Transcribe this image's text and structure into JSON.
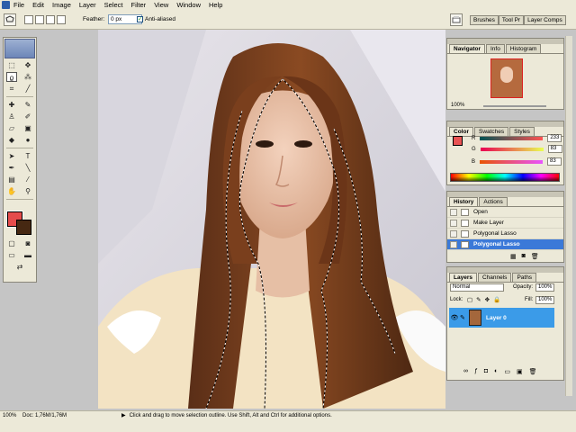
{
  "menu": [
    "File",
    "Edit",
    "Image",
    "Layer",
    "Select",
    "Filter",
    "View",
    "Window",
    "Help"
  ],
  "options": {
    "feather_label": "Feather:",
    "feather_value": "0 px",
    "anti_alias_label": "Anti-aliased",
    "well_tabs": [
      "Brushes",
      "Tool Pr",
      "Layer Comps"
    ]
  },
  "navigator": {
    "tabs": [
      "Navigator",
      "Info",
      "Histogram"
    ],
    "zoom": "100%"
  },
  "color": {
    "tabs": [
      "Color",
      "Swatches",
      "Styles"
    ],
    "channels": [
      {
        "label": "R",
        "value": "233"
      },
      {
        "label": "G",
        "value": "83"
      },
      {
        "label": "B",
        "value": "83"
      }
    ],
    "fg": "#e95353",
    "bg": "#462812"
  },
  "history": {
    "tabs": [
      "History",
      "Actions"
    ],
    "items": [
      "Open",
      "Make Layer",
      "Polygonal Lasso",
      "Polygonal Lasso"
    ]
  },
  "layers": {
    "tabs": [
      "Layers",
      "Channels",
      "Paths"
    ],
    "blend_mode": "Normal",
    "opacity_label": "Opacity:",
    "opacity_value": "100%",
    "lock_label": "Lock:",
    "fill_label": "Fill:",
    "fill_value": "100%",
    "layer_name": "Layer 0"
  },
  "status": {
    "zoom": "100%",
    "doc": "Doc: 1,76M/1,76M",
    "hint": "Click and drag to move selection outline.  Use Shift, Alt and Ctrl for additional options."
  }
}
